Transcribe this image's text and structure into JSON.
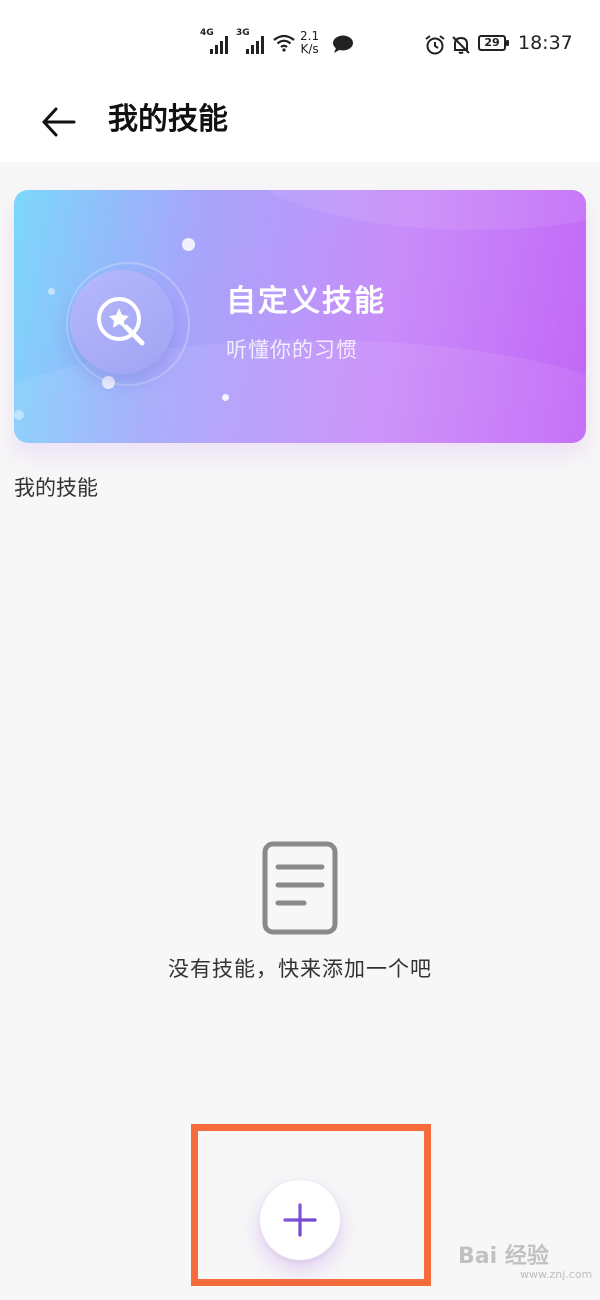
{
  "status_bar": {
    "net1": "4G",
    "net2": "3G",
    "speed_value": "2.1",
    "speed_unit": "K/s",
    "battery": "29",
    "time": "18:37"
  },
  "header": {
    "title": "我的技能"
  },
  "banner": {
    "title": "自定义技能",
    "subtitle": "听懂你的习惯",
    "colors": {
      "start": "#7bd8fb",
      "end": "#c266f7"
    }
  },
  "section": {
    "title": "我的技能"
  },
  "empty_state": {
    "message": "没有技能，快来添加一个吧"
  },
  "fab": {
    "icon": "plus-icon",
    "color": "#7b4fd6"
  },
  "highlight": {
    "color": "#f66b3c"
  },
  "watermark": {
    "text": "Bai 经验",
    "sub": "www.znj.com"
  }
}
